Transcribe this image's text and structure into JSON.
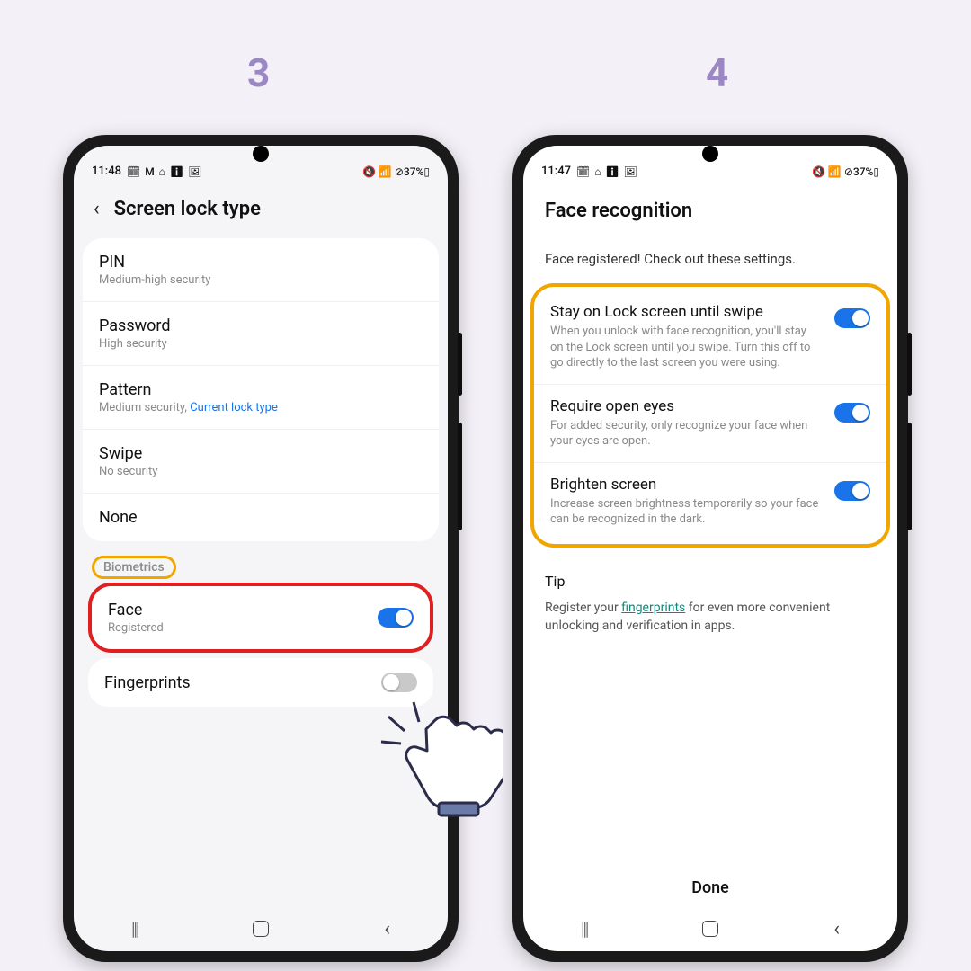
{
  "steps": {
    "three": "3",
    "four": "4"
  },
  "statusLeft": {
    "time": "11:48",
    "icons": "🗓 M ⌂ ℹ 🖼",
    "right": "🔇 📶 ⊘",
    "battery": "37%▯"
  },
  "statusRight": {
    "time": "11:47",
    "icons": "🗓 ⌂ ℹ 🖼",
    "right": "🔇 📶 ⊘",
    "battery": "37%▯"
  },
  "leftScreen": {
    "title": "Screen lock type",
    "rows": {
      "pin": {
        "label": "PIN",
        "sub": "Medium-high security"
      },
      "password": {
        "label": "Password",
        "sub": "High security"
      },
      "pattern": {
        "label": "Pattern",
        "sub": "Medium security, ",
        "link": "Current lock type"
      },
      "swipe": {
        "label": "Swipe",
        "sub": "No security"
      },
      "none": {
        "label": "None"
      }
    },
    "biometricsHeader": "Biometrics",
    "face": {
      "label": "Face",
      "sub": "Registered",
      "on": true
    },
    "fingerprints": {
      "label": "Fingerprints",
      "on": false
    }
  },
  "rightScreen": {
    "title": "Face recognition",
    "msg": "Face registered! Check out these settings.",
    "settings": {
      "stay": {
        "label": "Stay on Lock screen until swipe",
        "desc": "When you unlock with face recognition, you'll stay on the Lock screen until you swipe. Turn this off to go directly to the last screen you were using.",
        "on": true
      },
      "eyes": {
        "label": "Require open eyes",
        "desc": "For added security, only recognize your face when your eyes are open.",
        "on": true
      },
      "brighten": {
        "label": "Brighten screen",
        "desc": "Increase screen brightness temporarily so your face can be recognized in the dark.",
        "on": true
      }
    },
    "tipTitle": "Tip",
    "tipPre": "Register your ",
    "tipLink": "fingerprints",
    "tipPost": " for even more convenient unlocking and verification in apps.",
    "done": "Done"
  }
}
